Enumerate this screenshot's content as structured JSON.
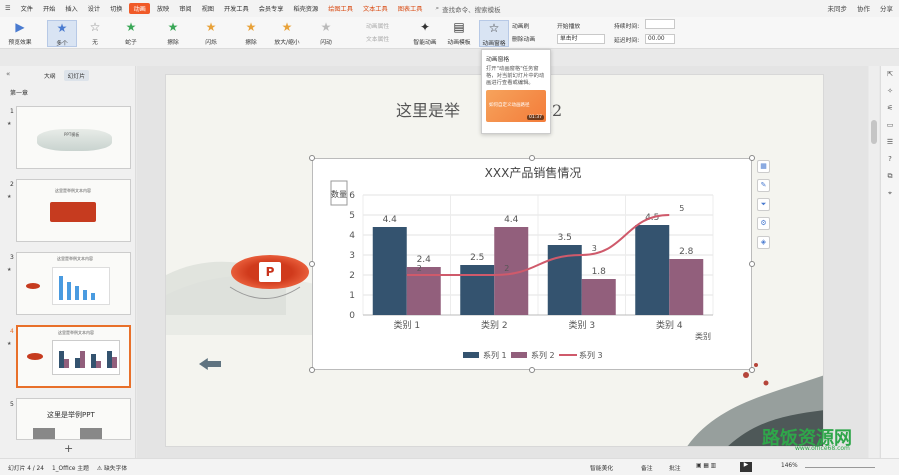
{
  "menubar": {
    "hamburger": "☰",
    "items": [
      "文件",
      "开始",
      "插入",
      "设计",
      "切换",
      "动画",
      "放映",
      "审阅",
      "视图",
      "开发工具",
      "会员专享",
      "稻壳资源"
    ],
    "active_index": 5,
    "context_tabs": [
      "绘图工具",
      "文本工具",
      "图表工具"
    ],
    "search_placeholder": "查找命令、搜索模板",
    "right": {
      "unsync": "未同步",
      "collab": "协作",
      "share": "分享"
    }
  },
  "ribbon": {
    "preview": "预览效果",
    "effects": [
      {
        "label": "多个",
        "icon": "★",
        "color": "#4a7bd0"
      },
      {
        "label": "无",
        "icon": "☆",
        "color": "#888"
      },
      {
        "label": "蛇子",
        "icon": "★",
        "color": "#3aa757"
      },
      {
        "label": "擦除",
        "icon": "★",
        "color": "#3aa757"
      },
      {
        "label": "闪烁",
        "icon": "★",
        "color": "#e8a23a"
      },
      {
        "label": "擦除",
        "icon": "★",
        "color": "#e8a23a"
      },
      {
        "label": "放大/缩小",
        "icon": "★",
        "color": "#e8a23a"
      },
      {
        "label": "闪动",
        "icon": "★",
        "color": "#bbb"
      }
    ],
    "anim_props": "动画属性",
    "text_props": "文本属性",
    "smart_anim": "智能动画",
    "anim_template": "动画模板",
    "anim_pane": "动画窗格",
    "anim_brush": "动画刷",
    "delete_anim": "删除动画",
    "start_play": "开始播放",
    "start_value": "单击时",
    "duration_label": "持续时间:",
    "delay_label": "延迟时间:",
    "delay_value": "00.00"
  },
  "tooltip": {
    "title": "动画窗格",
    "desc": "打开\"动画窗格\"任务窗格，对当前幻灯片中的动画进行查看或编辑。",
    "video_text": "如何自定义动画路径",
    "duration": "01:37"
  },
  "leftpane": {
    "tab_outline": "大纲",
    "tab_slides": "幻灯片",
    "section": "第一章",
    "thumbs": [
      {
        "num": "1",
        "caption": "PPT模板"
      },
      {
        "num": "2",
        "caption": "这里是举例文本内容"
      },
      {
        "num": "3",
        "caption": "这里是举例文本内容"
      },
      {
        "num": "4",
        "caption": "这里是举例文本内容"
      },
      {
        "num": "5",
        "caption": "这里是举例PPT"
      }
    ],
    "add": "+"
  },
  "slide": {
    "title_left": "这里是举",
    "title_right": "内容2",
    "watermark": "路饭资源网",
    "watermark_url": "www.office68.com"
  },
  "chart_data": {
    "type": "bar",
    "title": "XXX产品销售情况",
    "ylabel": "数量",
    "xlabel": "类别",
    "categories": [
      "类别 1",
      "类别 2",
      "类别 3",
      "类别 4"
    ],
    "ylim": [
      0,
      6
    ],
    "yticks": [
      0,
      1,
      2,
      3,
      4,
      5,
      6
    ],
    "series": [
      {
        "name": "系列 1",
        "kind": "bar",
        "color": "#34536f",
        "values": [
          4.4,
          2.5,
          3.5,
          4.5
        ]
      },
      {
        "name": "系列 2",
        "kind": "bar",
        "color": "#925f7c",
        "values": [
          2.4,
          4.4,
          1.8,
          2.8
        ]
      },
      {
        "name": "系列 3",
        "kind": "line",
        "color": "#cf5a6b",
        "values": [
          2,
          2,
          3,
          5
        ]
      }
    ],
    "legend_position": "bottom",
    "grid": true
  },
  "statusbar": {
    "slide_info": "幻灯片 4 / 24",
    "theme": "1_Office 主题",
    "missing_font": "缺失字体",
    "smart_beautify": "智能美化",
    "notes": "备注",
    "comments": "批注",
    "zoom": "146%"
  }
}
